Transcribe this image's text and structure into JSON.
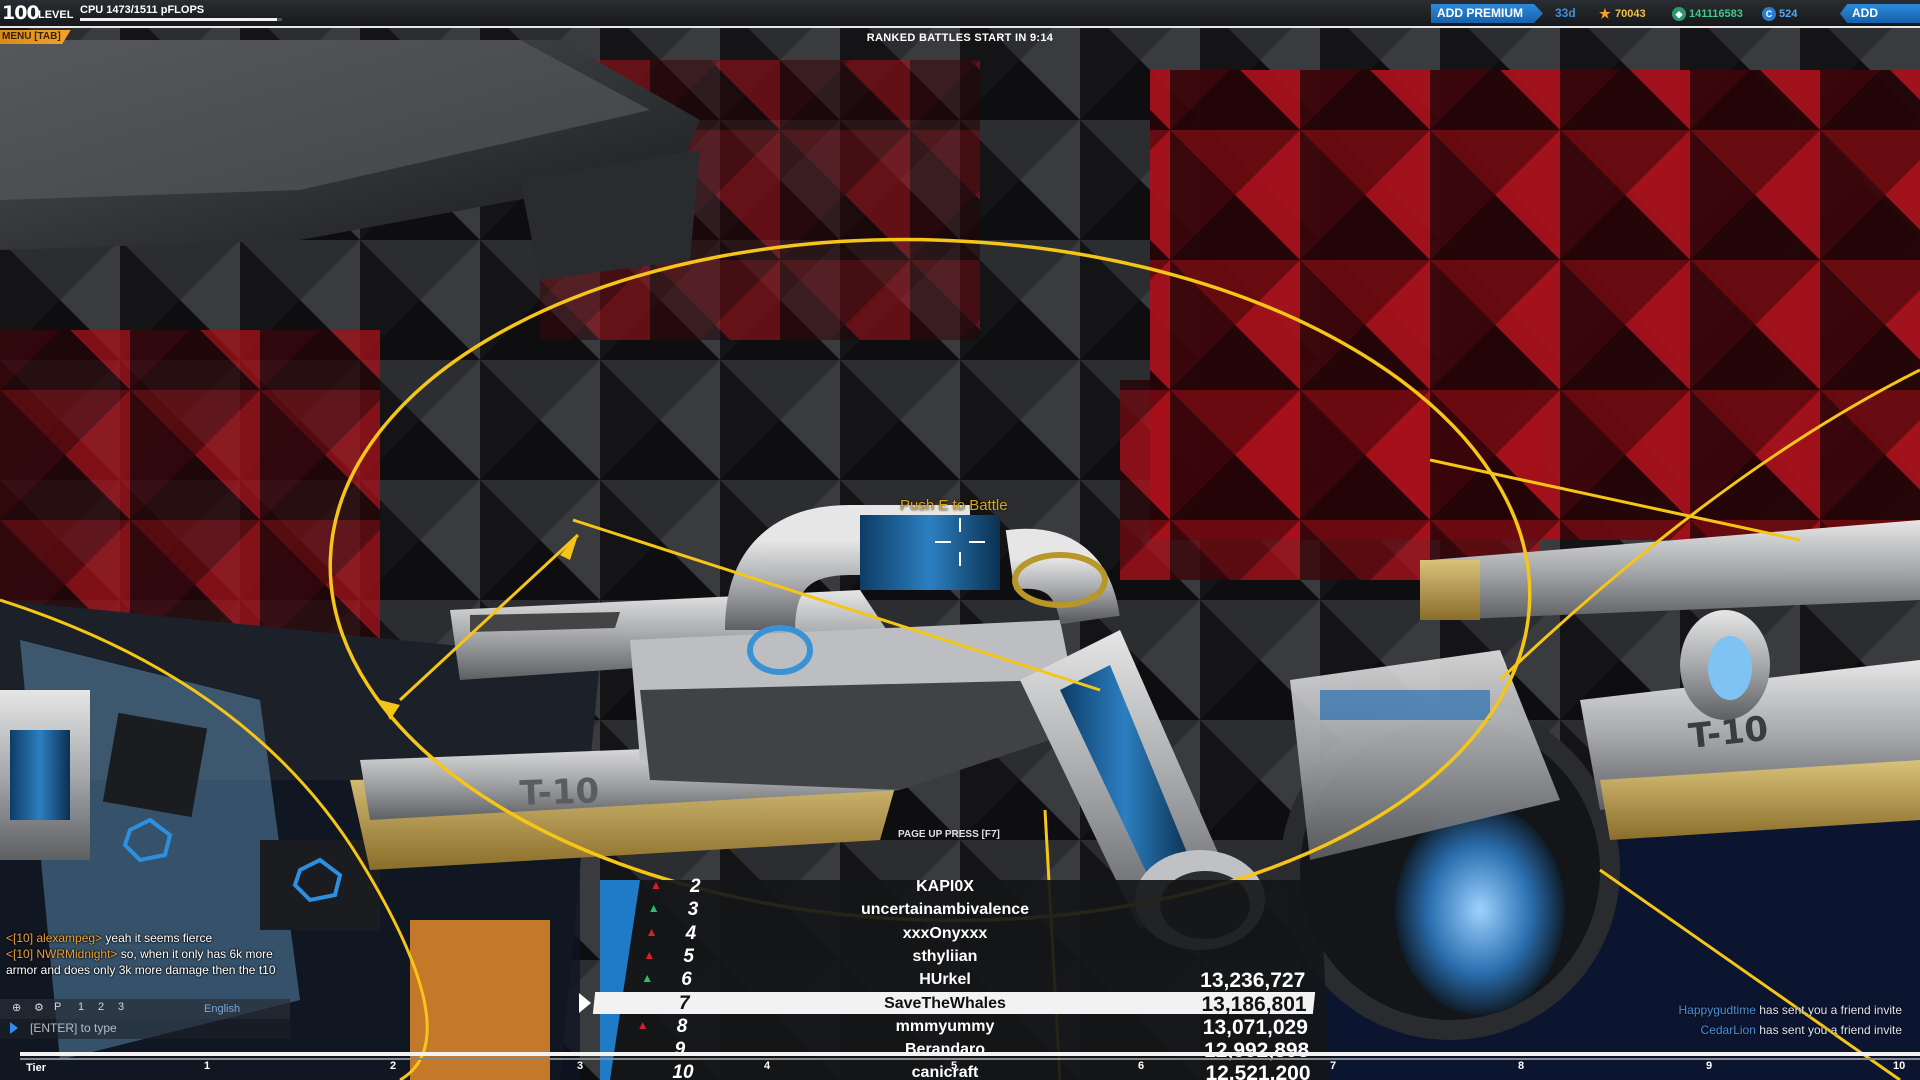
{
  "topbar": {
    "level_number": "100",
    "level_label": "LEVEL",
    "cpu_label": "CPU 1473/1511 pFLOPS",
    "cpu_fraction": 0.975,
    "menu_label": "MENU [TAB]",
    "ranked_text": "RANKED BATTLES START IN  9:14",
    "premium_button": "ADD PREMIUM",
    "premium_days": "33d",
    "tech_points": "70043",
    "robits": "141116583",
    "cosmetic_credits": "524",
    "funds_button": "ADD FUNDS"
  },
  "colors": {
    "accent_blue": "#1f76c7",
    "tier_gold": "#f5c518",
    "menu_orange": "#f2a32a"
  },
  "hud": {
    "prompt": "Push E to Battle"
  },
  "leaderboard": {
    "header_tier": "T-10",
    "page_hint": "PAGE UP PRESS  [F7]",
    "rows": [
      {
        "rank": "2",
        "name": "KAPI0X",
        "score": "",
        "trend": "down"
      },
      {
        "rank": "3",
        "name": "uncertainambivalence",
        "score": "",
        "trend": "up"
      },
      {
        "rank": "4",
        "name": "xxxOnyxxx",
        "score": "",
        "trend": "down"
      },
      {
        "rank": "5",
        "name": "sthyliian",
        "score": "",
        "trend": "down"
      },
      {
        "rank": "6",
        "name": "HUrkel",
        "score": "13,236,727",
        "trend": "up"
      },
      {
        "rank": "7",
        "name": "SaveTheWhales",
        "score": "13,186,801",
        "trend": "self"
      },
      {
        "rank": "8",
        "name": "mmmyummy",
        "score": "13,071,029",
        "trend": "down"
      },
      {
        "rank": "9",
        "name": "Berandaro",
        "score": "12,992,898",
        "trend": "none"
      },
      {
        "rank": "10",
        "name": "canicraft",
        "score": "12,521,200",
        "trend": "none"
      }
    ]
  },
  "chat": {
    "messages": [
      {
        "who": "<[10] alexampeg>",
        "text": " yeah it seems fierce"
      },
      {
        "who": "<[10] NWRMidnight>",
        "text": " so, when it only has 6k more armor and does only 3k more damage then the t10"
      }
    ],
    "language": "English",
    "input_placeholder": "[ENTER] to type",
    "tab_labels": [
      "P",
      "1",
      "2",
      "3"
    ]
  },
  "notifications": [
    {
      "name": "Happygudtime",
      "text": " has sent you a friend invite"
    },
    {
      "name": "CedarLion",
      "text": " has sent you a friend invite"
    }
  ],
  "tierbar": {
    "label": "Tier",
    "ticks": [
      "1",
      "2",
      "3",
      "4",
      "5",
      "6",
      "7",
      "8",
      "9",
      "10"
    ]
  }
}
